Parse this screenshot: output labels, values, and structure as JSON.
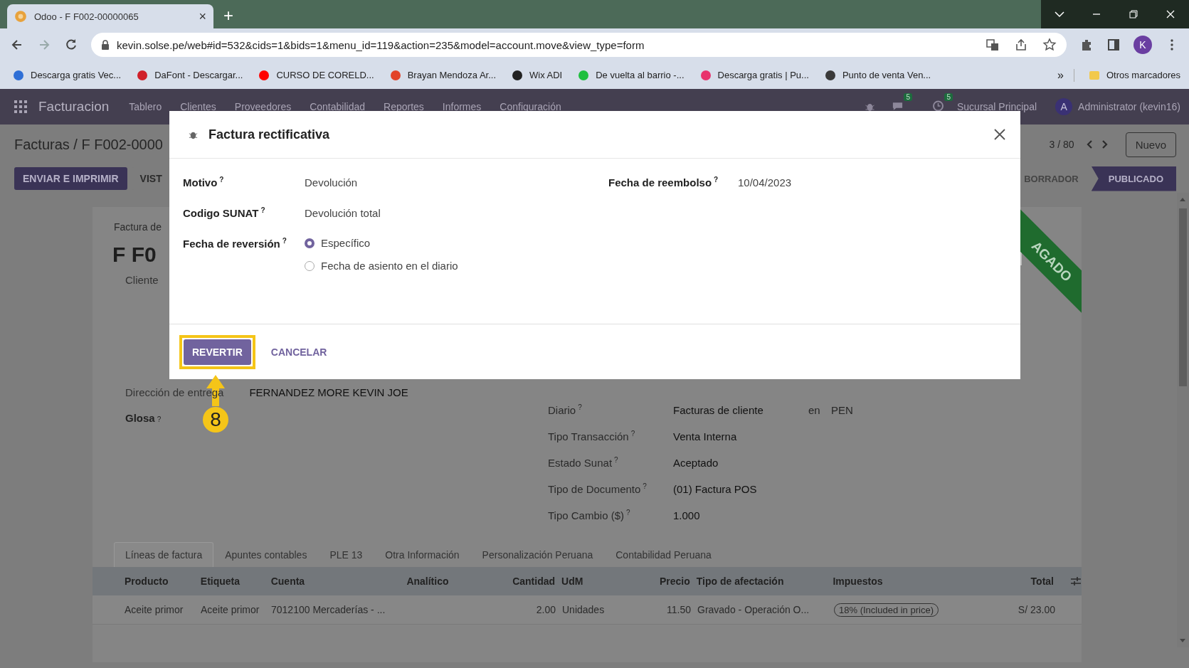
{
  "browser": {
    "tab_title": "Odoo - F F002-00000065",
    "tab_close": "×",
    "new_tab": "+",
    "url": "kevin.solse.pe/web#id=532&cids=1&bids=1&menu_id=119&action=235&model=account.move&view_type=form",
    "profile_initial": "K",
    "bookmarks": [
      {
        "label": "Descarga gratis Vec...",
        "color": "#2f6fd6"
      },
      {
        "label": "DaFont - Descargar...",
        "color": "#d0202a"
      },
      {
        "label": "CURSO DE CORELD...",
        "color": "#ff0000"
      },
      {
        "label": "Brayan Mendoza Ar...",
        "color": "#e24329"
      },
      {
        "label": "Wix ADI",
        "color": "#222222"
      },
      {
        "label": "De vuelta al barrio -...",
        "color": "#1fbf3f"
      },
      {
        "label": "Descarga gratis | Pu...",
        "color": "#e8336d"
      },
      {
        "label": "Punto de venta Ven...",
        "color": "#3a3a3a"
      }
    ],
    "more": "»",
    "other_bookmarks": "Otros marcadores"
  },
  "navbar": {
    "app_name": "Facturacion",
    "menu": [
      "Tablero",
      "Clientes",
      "Proveedores",
      "Contabilidad",
      "Reportes",
      "Informes",
      "Configuración"
    ],
    "chat_count": "5",
    "activity_count": "5",
    "company": "Sucursal Principal",
    "user_initial": "A",
    "user_name": "Administrator (kevin16)"
  },
  "control_panel": {
    "breadcrumb": "Facturas / F F002-0000",
    "pager": "3 / 80",
    "new_button": "Nuevo",
    "actions": [
      "ENVIAR E IMPRIMIR",
      "VIST"
    ],
    "statuses": [
      {
        "label": "BORRADOR",
        "selected": false
      },
      {
        "label": "PUBLICADO",
        "selected": true
      }
    ]
  },
  "form": {
    "subtitle": "Factura de",
    "number": "F F0",
    "ribbon": "AGADO",
    "left_fields": [
      {
        "label": "Cliente"
      },
      {
        "label": "Dirección de entrega",
        "value": "FERNANDEZ MORE KEVIN JOE"
      },
      {
        "label": "Glosa",
        "hint": "?"
      }
    ],
    "right_fields": [
      {
        "label": "Diario",
        "hint": "?",
        "value": "Facturas de cliente",
        "extra_label": "en",
        "extra_value": "PEN"
      },
      {
        "label": "Tipo Transacción",
        "hint": "?",
        "value": "Venta Interna"
      },
      {
        "label": "Estado Sunat",
        "hint": "?",
        "value": "Aceptado"
      },
      {
        "label": "Tipo de Documento",
        "hint": "?",
        "value": "(01) Factura POS"
      },
      {
        "label": "Tipo Cambio ($)",
        "hint": "?",
        "value": "1.000"
      }
    ],
    "tabs": [
      {
        "label": "Líneas de factura",
        "selected": true
      },
      {
        "label": "Apuntes contables",
        "selected": false
      },
      {
        "label": "PLE 13",
        "selected": false
      },
      {
        "label": "Otra Información",
        "selected": false
      },
      {
        "label": "Personalización Peruana",
        "selected": false
      },
      {
        "label": "Contabilidad Peruana",
        "selected": false
      }
    ],
    "table": {
      "columns": [
        "Producto",
        "Etiqueta",
        "Cuenta",
        "Analítico",
        "Cantidad",
        "UdM",
        "Precio",
        "Tipo de afectación",
        "Impuestos",
        "Total"
      ],
      "rows": [
        {
          "cells": [
            "Aceite primor",
            "Aceite primor",
            "7012100 Mercaderías - ...",
            "",
            "2.00",
            "Unidades",
            "11.50",
            "Gravado - Operación O...",
            "18% (Included in price)",
            "S/ 23.00"
          ]
        }
      ]
    }
  },
  "dialog": {
    "title": "Factura rectificativa",
    "left_fields": [
      {
        "label": "Motivo",
        "hint": "?",
        "value": "Devolución"
      },
      {
        "label": "Codigo SUNAT",
        "hint": "?",
        "value": "Devolución total"
      }
    ],
    "reversal": {
      "label": "Fecha de reversión",
      "hint": "?",
      "options": [
        {
          "label": "Específico",
          "selected": true
        },
        {
          "label": "Fecha de asiento en el diario",
          "selected": false
        }
      ]
    },
    "right_fields": [
      {
        "label": "Fecha de reembolso",
        "hint": "?",
        "value": "10/04/2023"
      }
    ],
    "buttons": [
      {
        "label": "REVERTIR",
        "kind": "primary",
        "highlighted": true
      },
      {
        "label": "CANCELAR",
        "kind": "link",
        "highlighted": false
      }
    ],
    "step": "8"
  }
}
